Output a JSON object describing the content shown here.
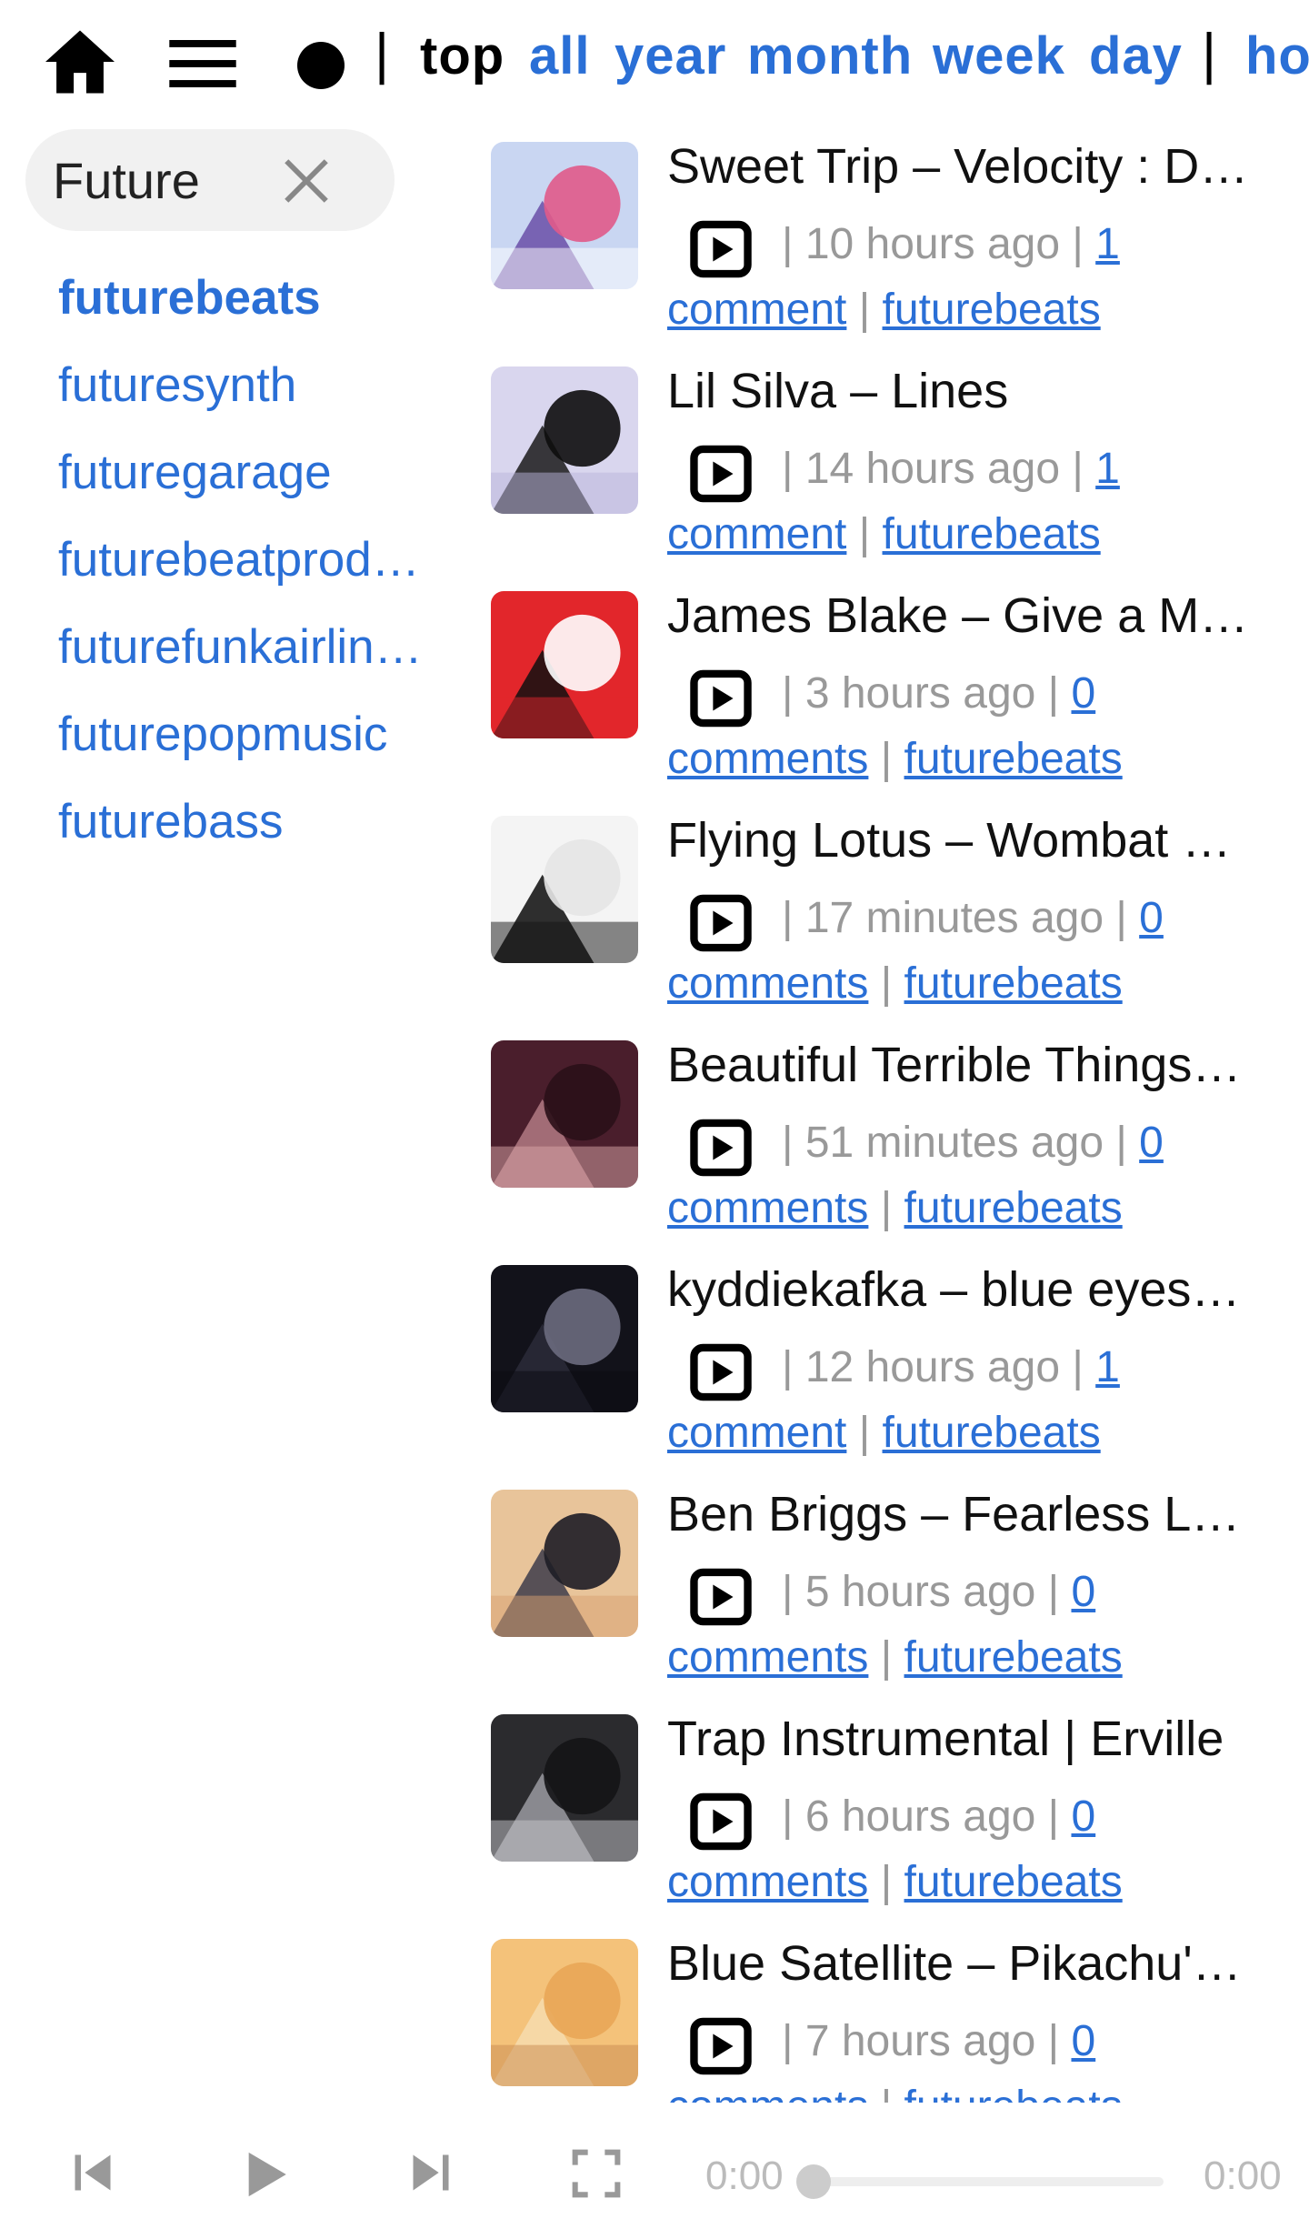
{
  "topbar": {
    "icons": [
      "home-icon",
      "menu-icon",
      "circle-icon"
    ],
    "separator": "|",
    "sort_active": "top",
    "sort_links": [
      "all",
      "year",
      "month",
      "week",
      "day"
    ],
    "sort_overflow": "ho"
  },
  "sidebar": {
    "search": {
      "value": "Future",
      "placeholder": ""
    },
    "clear_icon": "close-icon",
    "subreddits": [
      "futurebeats",
      "futuresynth",
      "futuregarage",
      "futurebeatprod…",
      "futurefunkairlin…",
      "futurepopmusic",
      "futurebass"
    ],
    "active_index": 0
  },
  "posts": [
    {
      "title": "Sweet Trip – Velocity : De…",
      "time": "10 hours ago",
      "comment_count": "1",
      "comment_word": "comment",
      "subreddit": "futurebeats",
      "thumb_colors": [
        "#c9d6f2",
        "#6a4fa8",
        "#e05a8a",
        "#ffffff"
      ]
    },
    {
      "title": "Lil Silva – Lines",
      "time": "14 hours ago",
      "comment_count": "1",
      "comment_word": "comment",
      "subreddit": "futurebeats",
      "thumb_colors": [
        "#d9d6ee",
        "#1a1a1a",
        "#0d0d0d",
        "#b9b3d9"
      ]
    },
    {
      "title": "James Blake – Give a Ma…",
      "time": "3 hours ago",
      "comment_count": "0",
      "comment_word": "comments",
      "subreddit": "futurebeats",
      "thumb_colors": [
        "#e2262b",
        "#111111",
        "#ffffff",
        "#e2262b"
      ]
    },
    {
      "title": "Flying Lotus – Wombat C…",
      "time": "17 minutes ago",
      "comment_count": "0",
      "comment_word": "comments",
      "subreddit": "futurebeats",
      "thumb_colors": [
        "#f4f4f4",
        "#0b0b0b",
        "#e6e6e6",
        "#141414"
      ]
    },
    {
      "title": "Beautiful Terrible Things …",
      "time": "51 minutes ago",
      "comment_count": "0",
      "comment_word": "comments",
      "subreddit": "futurebeats",
      "thumb_colors": [
        "#4a1e2c",
        "#b27a84",
        "#2a0f18",
        "#d9a5a8"
      ]
    },
    {
      "title": "kyddiekafka – blue eyes […",
      "time": "12 hours ago",
      "comment_count": "1",
      "comment_word": "comment",
      "subreddit": "futurebeats",
      "thumb_colors": [
        "#12121a",
        "#2c2c3a",
        "#6b6b7e",
        "#0a0a10"
      ]
    },
    {
      "title": "Ben Briggs – Fearless Livi…",
      "time": "5 hours ago",
      "comment_count": "0",
      "comment_word": "comments",
      "subreddit": "futurebeats",
      "thumb_colors": [
        "#e8c49a",
        "#3d3c4a",
        "#1e1d26",
        "#d8a070"
      ]
    },
    {
      "title": "Trap Instrumental | Erville",
      "time": "6 hours ago",
      "comment_count": "0",
      "comment_word": "comments",
      "subreddit": "futurebeats",
      "thumb_colors": [
        "#2b2b2e",
        "#9a9aa0",
        "#141416",
        "#c8c8cc"
      ]
    },
    {
      "title": "Blue Satellite – Pikachu's …",
      "time": "7 hours ago",
      "comment_count": "0",
      "comment_word": "comments",
      "subreddit": "futurebeats",
      "thumb_colors": [
        "#f4c27a",
        "#f6dcae",
        "#e9a657",
        "#c88a50"
      ]
    }
  ],
  "player": {
    "icons": [
      "skip-previous-icon",
      "play-icon",
      "skip-next-icon",
      "fullscreen-icon"
    ],
    "time_current": "0:00",
    "time_total": "0:00",
    "progress": 0
  },
  "colors": {
    "link": "#2a6fd6",
    "meta": "#999999",
    "text": "#111111",
    "pill": "#f1f1f1"
  }
}
